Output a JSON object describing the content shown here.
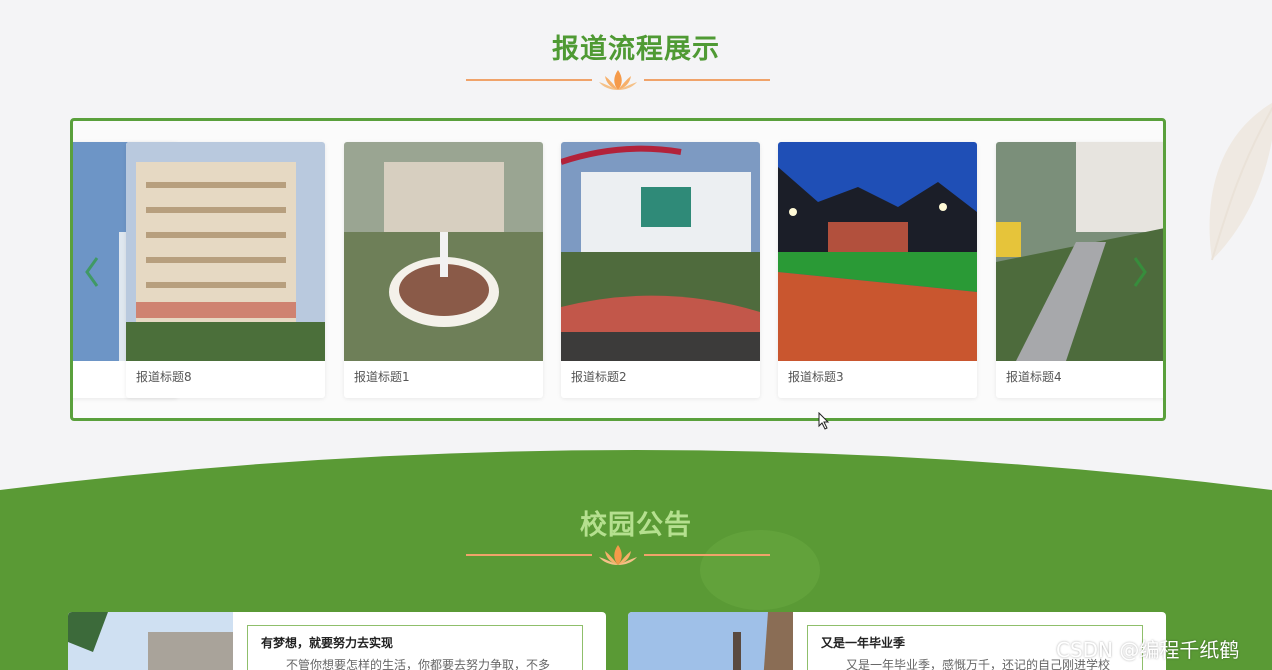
{
  "sections": {
    "process_title": "报道流程展示",
    "notice_title": "校园公告"
  },
  "carousel": {
    "items": [
      {
        "caption": "报道标题8"
      },
      {
        "caption": "报道标题1"
      },
      {
        "caption": "报道标题2"
      },
      {
        "caption": "报道标题3"
      },
      {
        "caption": "报道标题4"
      }
    ]
  },
  "notices": [
    {
      "title": "有梦想，就要努力去实现",
      "excerpt": "不管你想要怎样的生活，你都要去努力争取，不多"
    },
    {
      "title": "又是一年毕业季",
      "excerpt": "又是一年毕业季，感慨万千，还记的自己刚进学校"
    }
  ],
  "watermark": "CSDN @编程千纸鹤",
  "colors": {
    "brand_green": "#5aa03c",
    "title_green": "#4f9a34",
    "accent_orange": "#f0a36a"
  },
  "icons": {
    "divider": "lotus-icon",
    "prev": "chevron-left-icon",
    "next": "chevron-right-icon"
  }
}
